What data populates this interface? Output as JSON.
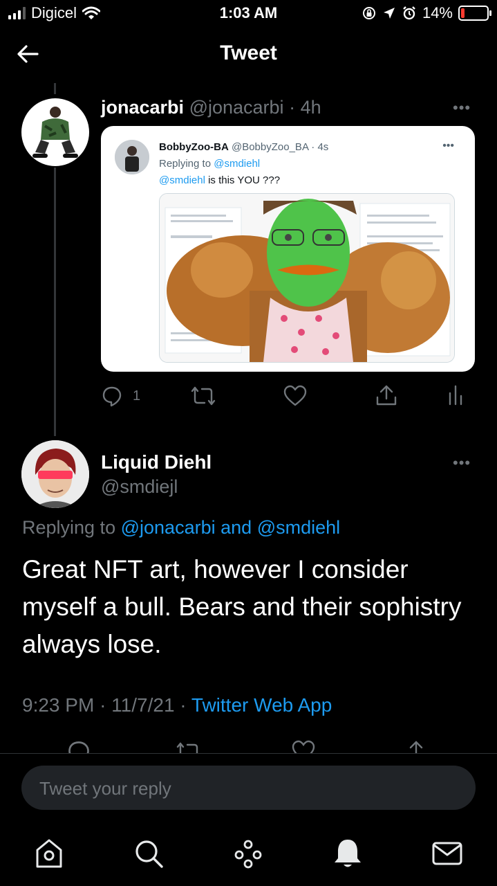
{
  "status_bar": {
    "carrier": "Digicel",
    "time": "1:03 AM",
    "battery_percent": "14%",
    "battery_level": 0.14,
    "battery_color": "#ff3b30",
    "icons": [
      "signal-bars-icon",
      "wifi-icon",
      "orientation-lock-icon",
      "location-icon",
      "alarm-icon",
      "battery-icon"
    ]
  },
  "header": {
    "title": "Tweet",
    "back_icon": "back-arrow-icon"
  },
  "parent_tweet": {
    "display_name": "jonacarbi",
    "handle": "@jonacarbi",
    "separator": "·",
    "time_ago": "4h",
    "more": "•••",
    "embedded_tweet": {
      "display_name": "BobbyZoo-BA",
      "handle": "@BobbyZoo_BA",
      "separator": "·",
      "time_ago": "4s",
      "replying_prefix": "Replying to",
      "replying_handle": "@smdiehl",
      "text_mention": "@smdiehl",
      "text_rest": "is this YOU ???",
      "more": "•••"
    },
    "actions": {
      "reply_count": "1"
    }
  },
  "main_tweet": {
    "display_name": "Liquid Diehl",
    "handle": "@smdiejl",
    "more": "•••",
    "replying_prefix": "Replying to",
    "replying_to_1": "@jonacarbi",
    "replying_and": "and",
    "replying_to_2": "@smdiehl",
    "text": "Great NFT art, however I consider myself a bull. Bears and their sophistry always lose.",
    "time": "9:23 PM",
    "separator": "·",
    "date": "11/7/21",
    "source": "Twitter Web App"
  },
  "reply_box": {
    "placeholder": "Tweet your reply"
  },
  "tab_bar": {
    "items": [
      "home-icon",
      "search-icon",
      "spaces-icon",
      "notifications-icon",
      "messages-icon"
    ]
  },
  "colors": {
    "accent": "#1d9bf0",
    "background": "#000000",
    "muted_text": "#71767b"
  }
}
